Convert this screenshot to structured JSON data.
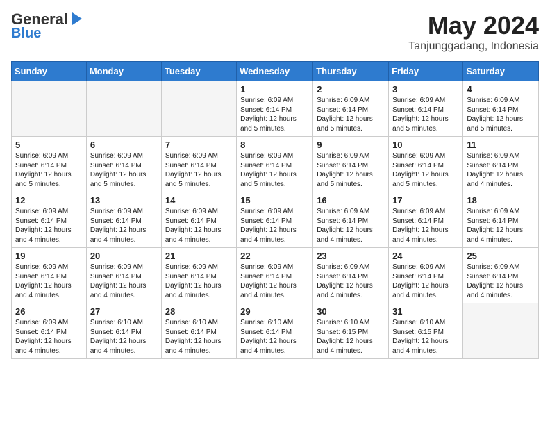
{
  "logo": {
    "line1": "General",
    "line2": "Blue"
  },
  "title": "May 2024",
  "location": "Tanjunggadang, Indonesia",
  "weekdays": [
    "Sunday",
    "Monday",
    "Tuesday",
    "Wednesday",
    "Thursday",
    "Friday",
    "Saturday"
  ],
  "weeks": [
    [
      {
        "day": "",
        "info": ""
      },
      {
        "day": "",
        "info": ""
      },
      {
        "day": "",
        "info": ""
      },
      {
        "day": "1",
        "info": "Sunrise: 6:09 AM\nSunset: 6:14 PM\nDaylight: 12 hours\nand 5 minutes."
      },
      {
        "day": "2",
        "info": "Sunrise: 6:09 AM\nSunset: 6:14 PM\nDaylight: 12 hours\nand 5 minutes."
      },
      {
        "day": "3",
        "info": "Sunrise: 6:09 AM\nSunset: 6:14 PM\nDaylight: 12 hours\nand 5 minutes."
      },
      {
        "day": "4",
        "info": "Sunrise: 6:09 AM\nSunset: 6:14 PM\nDaylight: 12 hours\nand 5 minutes."
      }
    ],
    [
      {
        "day": "5",
        "info": "Sunrise: 6:09 AM\nSunset: 6:14 PM\nDaylight: 12 hours\nand 5 minutes."
      },
      {
        "day": "6",
        "info": "Sunrise: 6:09 AM\nSunset: 6:14 PM\nDaylight: 12 hours\nand 5 minutes."
      },
      {
        "day": "7",
        "info": "Sunrise: 6:09 AM\nSunset: 6:14 PM\nDaylight: 12 hours\nand 5 minutes."
      },
      {
        "day": "8",
        "info": "Sunrise: 6:09 AM\nSunset: 6:14 PM\nDaylight: 12 hours\nand 5 minutes."
      },
      {
        "day": "9",
        "info": "Sunrise: 6:09 AM\nSunset: 6:14 PM\nDaylight: 12 hours\nand 5 minutes."
      },
      {
        "day": "10",
        "info": "Sunrise: 6:09 AM\nSunset: 6:14 PM\nDaylight: 12 hours\nand 5 minutes."
      },
      {
        "day": "11",
        "info": "Sunrise: 6:09 AM\nSunset: 6:14 PM\nDaylight: 12 hours\nand 4 minutes."
      }
    ],
    [
      {
        "day": "12",
        "info": "Sunrise: 6:09 AM\nSunset: 6:14 PM\nDaylight: 12 hours\nand 4 minutes."
      },
      {
        "day": "13",
        "info": "Sunrise: 6:09 AM\nSunset: 6:14 PM\nDaylight: 12 hours\nand 4 minutes."
      },
      {
        "day": "14",
        "info": "Sunrise: 6:09 AM\nSunset: 6:14 PM\nDaylight: 12 hours\nand 4 minutes."
      },
      {
        "day": "15",
        "info": "Sunrise: 6:09 AM\nSunset: 6:14 PM\nDaylight: 12 hours\nand 4 minutes."
      },
      {
        "day": "16",
        "info": "Sunrise: 6:09 AM\nSunset: 6:14 PM\nDaylight: 12 hours\nand 4 minutes."
      },
      {
        "day": "17",
        "info": "Sunrise: 6:09 AM\nSunset: 6:14 PM\nDaylight: 12 hours\nand 4 minutes."
      },
      {
        "day": "18",
        "info": "Sunrise: 6:09 AM\nSunset: 6:14 PM\nDaylight: 12 hours\nand 4 minutes."
      }
    ],
    [
      {
        "day": "19",
        "info": "Sunrise: 6:09 AM\nSunset: 6:14 PM\nDaylight: 12 hours\nand 4 minutes."
      },
      {
        "day": "20",
        "info": "Sunrise: 6:09 AM\nSunset: 6:14 PM\nDaylight: 12 hours\nand 4 minutes."
      },
      {
        "day": "21",
        "info": "Sunrise: 6:09 AM\nSunset: 6:14 PM\nDaylight: 12 hours\nand 4 minutes."
      },
      {
        "day": "22",
        "info": "Sunrise: 6:09 AM\nSunset: 6:14 PM\nDaylight: 12 hours\nand 4 minutes."
      },
      {
        "day": "23",
        "info": "Sunrise: 6:09 AM\nSunset: 6:14 PM\nDaylight: 12 hours\nand 4 minutes."
      },
      {
        "day": "24",
        "info": "Sunrise: 6:09 AM\nSunset: 6:14 PM\nDaylight: 12 hours\nand 4 minutes."
      },
      {
        "day": "25",
        "info": "Sunrise: 6:09 AM\nSunset: 6:14 PM\nDaylight: 12 hours\nand 4 minutes."
      }
    ],
    [
      {
        "day": "26",
        "info": "Sunrise: 6:09 AM\nSunset: 6:14 PM\nDaylight: 12 hours\nand 4 minutes."
      },
      {
        "day": "27",
        "info": "Sunrise: 6:10 AM\nSunset: 6:14 PM\nDaylight: 12 hours\nand 4 minutes."
      },
      {
        "day": "28",
        "info": "Sunrise: 6:10 AM\nSunset: 6:14 PM\nDaylight: 12 hours\nand 4 minutes."
      },
      {
        "day": "29",
        "info": "Sunrise: 6:10 AM\nSunset: 6:14 PM\nDaylight: 12 hours\nand 4 minutes."
      },
      {
        "day": "30",
        "info": "Sunrise: 6:10 AM\nSunset: 6:15 PM\nDaylight: 12 hours\nand 4 minutes."
      },
      {
        "day": "31",
        "info": "Sunrise: 6:10 AM\nSunset: 6:15 PM\nDaylight: 12 hours\nand 4 minutes."
      },
      {
        "day": "",
        "info": ""
      }
    ]
  ]
}
